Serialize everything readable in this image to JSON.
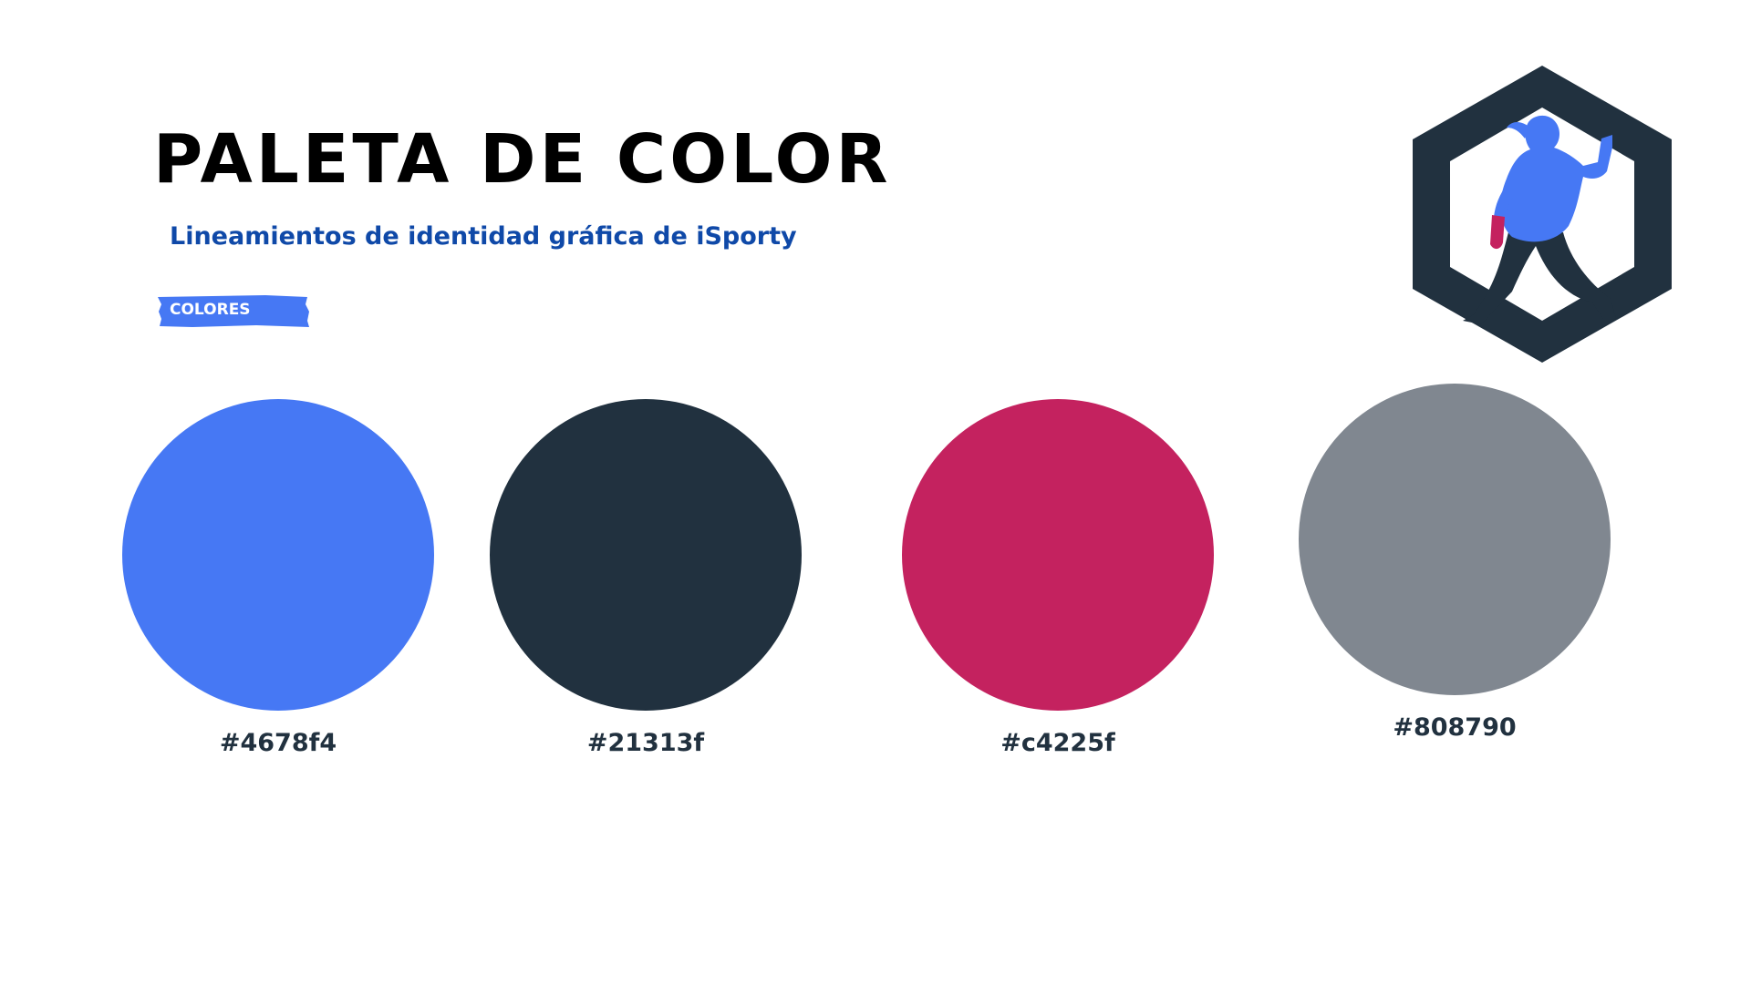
{
  "header": {
    "title": "PALETA DE COLOR",
    "subtitle": "Lineamientos de identidad gráfica de iSporty",
    "tag_label": "COLORES",
    "tag_color": "#4678f4"
  },
  "logo": {
    "icon": "runner-hexagon-logo",
    "colors": [
      "#21313f",
      "#4678f4",
      "#c4225f"
    ]
  },
  "palette": [
    {
      "hex": "#4678f4",
      "label": "#4678f4"
    },
    {
      "hex": "#21313f",
      "label": "#21313f"
    },
    {
      "hex": "#c4225f",
      "label": "#c4225f"
    },
    {
      "hex": "#808790",
      "label": "#808790"
    }
  ]
}
